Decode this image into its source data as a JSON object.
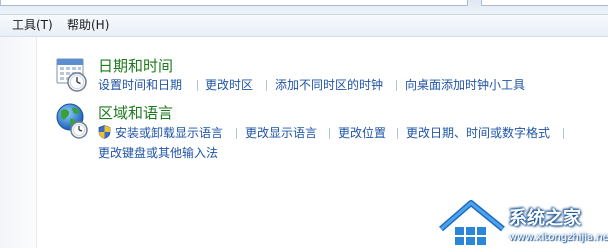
{
  "menu": {
    "tools": "工具(T)",
    "help": "帮助(H)"
  },
  "date_time": {
    "title": "日期和时间",
    "links": [
      "设置时间和日期",
      "更改时区",
      "添加不同时区的时钟",
      "向桌面添加时钟小工具"
    ]
  },
  "region_language": {
    "title": "区域和语言",
    "links": [
      "安装或卸载显示语言",
      "更改显示语言",
      "更改位置",
      "更改日期、时间或数字格式"
    ],
    "link_row2": "更改键盘或其他输入法"
  },
  "watermark": {
    "text": "系统之家",
    "url": "www.xitongzhijia.net"
  },
  "colors": {
    "category_title": "#1e7a1e",
    "link": "#1f54a6",
    "menubar": "#e9eff7"
  },
  "icons": [
    "calendar-clock-icon",
    "globe-clock-icon",
    "uac-shield-icon",
    "watermark-house-logo-icon"
  ]
}
